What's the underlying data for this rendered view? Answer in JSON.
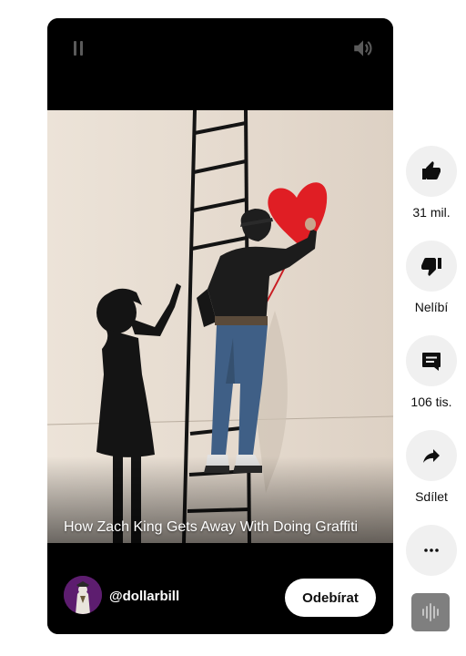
{
  "video": {
    "title": "How Zach King Gets Away With Doing Graffiti",
    "controls": {
      "pause_icon": "pause-icon",
      "volume_icon": "volume-icon"
    }
  },
  "channel": {
    "handle": "@dollarbill",
    "avatar_color": "#5d1d6f",
    "subscribe_label": "Odebírat"
  },
  "actions": {
    "like": {
      "label": "31 mil.",
      "icon": "thumbs-up-icon"
    },
    "dislike": {
      "label": "Nelíbí",
      "icon": "thumbs-down-icon"
    },
    "comments": {
      "label": "106 tis.",
      "icon": "comment-icon"
    },
    "share": {
      "label": "Sdílet",
      "icon": "share-icon"
    },
    "more": {
      "icon": "more-horizontal-icon"
    }
  },
  "sound": {
    "icon": "sound-waveform-icon"
  },
  "colors": {
    "player_bg": "#000000",
    "action_bg": "#f0f0f0",
    "heart": "#e01e24",
    "wall": "#e6dcd1"
  }
}
